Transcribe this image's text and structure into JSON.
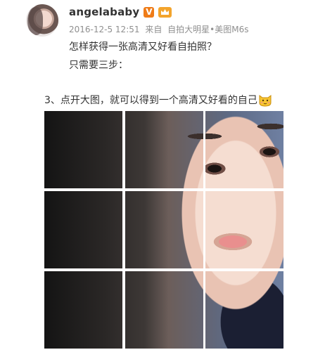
{
  "post": {
    "username": "angelababy",
    "verified_badge": "V",
    "meta": {
      "datetime": "2016-12-5 12:51",
      "from_label": "来自",
      "device": "自拍大明星•美图M6s"
    },
    "text": {
      "line1": "怎样获得一张高清又好看自拍照？",
      "line2": "只需要三步：",
      "step": "3、点开大图，就可以得到一个高清又好看的自己"
    },
    "icons": {
      "verified": "verified-v-icon",
      "member": "crown-icon",
      "emoji": "cat-emoji-icon"
    },
    "colors": {
      "badge_orange": "#ef7c18",
      "meta_gray": "#8f8f8f"
    }
  }
}
